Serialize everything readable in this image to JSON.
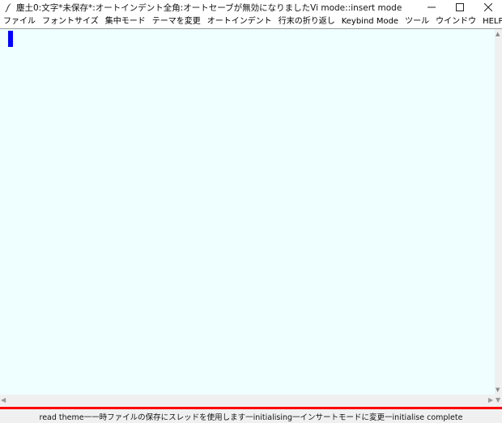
{
  "window": {
    "title": "塵土0:文字*未保存*:オートインデント全角:オートセーブが無効になりましたVi mode::insert mode",
    "icon": "feather-icon"
  },
  "menubar": {
    "items": [
      {
        "label": "ファイル"
      },
      {
        "label": "フォントサイズ"
      },
      {
        "label": "集中モード"
      },
      {
        "label": "テーマを変更"
      },
      {
        "label": "オートインデント"
      },
      {
        "label": "行末の折り返し"
      },
      {
        "label": "Keybind Mode"
      },
      {
        "label": "ツール"
      },
      {
        "label": "ウインドウ"
      },
      {
        "label": "HELP"
      }
    ]
  },
  "editor": {
    "content": "",
    "background": "#efffff",
    "cursor_color": "#0000ff"
  },
  "status": {
    "text": "read theme一一時ファイルの保存にスレッドを使用します一initialising一インサートモードに変更一initialise complete"
  },
  "colors": {
    "accent_line": "#ff0000"
  }
}
